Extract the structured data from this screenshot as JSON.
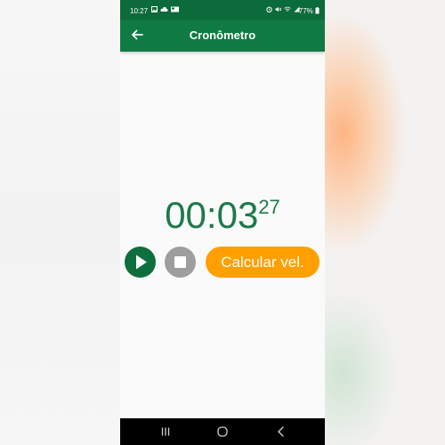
{
  "status_bar": {
    "time": "10:27",
    "battery": "77%",
    "left_icons": [
      "image-icon",
      "cloud-icon",
      "news-icon"
    ],
    "right_icons": [
      "alarm-icon",
      "mute-icon",
      "wifi-icon",
      "signal-icon"
    ]
  },
  "app_bar": {
    "title": "Cronômetro",
    "back_icon": "arrow-left-icon"
  },
  "timer": {
    "main": "00:03",
    "centiseconds": "27"
  },
  "controls": {
    "play_icon": "play-icon",
    "stop_icon": "stop-icon",
    "calc_label": "Calcular vel."
  },
  "nav_bar": {
    "buttons": [
      "recent-apps-icon",
      "home-icon",
      "back-icon"
    ]
  },
  "colors": {
    "status_bar": "#0c6b3a",
    "app_bar": "#0f7a43",
    "timer_text": "#1c7a4a",
    "play_button": "#0f6e3d",
    "stop_button": "#9e9e9e",
    "calc_button": "#ff9f00"
  }
}
